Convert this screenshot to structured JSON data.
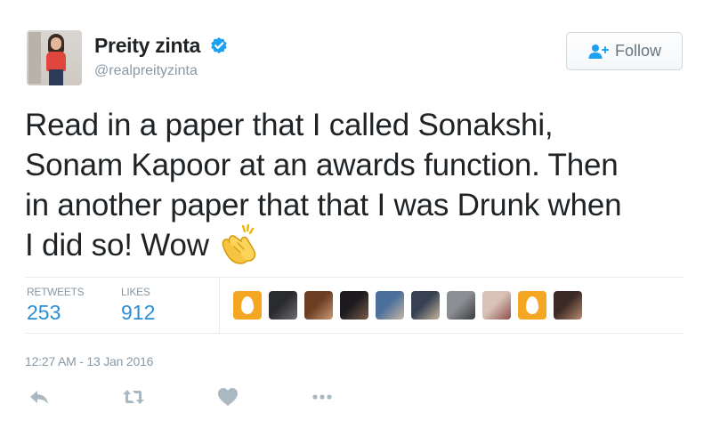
{
  "user": {
    "name": "Preity zinta",
    "handle": "@realpreityzinta",
    "verified": true,
    "avatar_icon": "profile-photo"
  },
  "follow_button": {
    "label": "Follow",
    "icon": "add-user-icon"
  },
  "tweet": {
    "lines": [
      "Read in a paper that I called Sonakshi,",
      "Sonam Kapoor at an awards function. Then",
      "in another paper that that I was Drunk when",
      "I did so! Wow"
    ],
    "emoji": "clapping-hands-emoji"
  },
  "stats": {
    "retweets_label": "RETWEETS",
    "retweets_value": "253",
    "likes_label": "LIKES",
    "likes_value": "912"
  },
  "likers": [
    {
      "kind": "egg",
      "color": "#f5a623"
    },
    {
      "kind": "photo",
      "colors": [
        "#2a2b2e",
        "#6d6e72"
      ]
    },
    {
      "kind": "photo",
      "colors": [
        "#6b3d22",
        "#c99a74"
      ]
    },
    {
      "kind": "photo",
      "colors": [
        "#1d1b1f",
        "#7a5b4c"
      ]
    },
    {
      "kind": "photo",
      "colors": [
        "#4c6f9c",
        "#c7b7a3"
      ]
    },
    {
      "kind": "photo",
      "colors": [
        "#374152",
        "#c6b49a"
      ]
    },
    {
      "kind": "photo",
      "colors": [
        "#8c8f93",
        "#3b3c3f"
      ]
    },
    {
      "kind": "photo",
      "colors": [
        "#d8c2b7",
        "#8e4f4b"
      ]
    },
    {
      "kind": "egg",
      "color": "#f5a623"
    },
    {
      "kind": "photo",
      "colors": [
        "#3b2a26",
        "#b98a6e"
      ]
    }
  ],
  "timestamp": "12:27 AM - 13 Jan 2016",
  "actions": [
    {
      "name": "reply-icon"
    },
    {
      "name": "retweet-icon"
    },
    {
      "name": "like-icon"
    },
    {
      "name": "more-icon"
    }
  ],
  "colors": {
    "link_blue": "#2a8ed6",
    "muted_gray": "#8899a6",
    "verified_blue": "#1da1f2",
    "action_gray": "#aab8c2"
  }
}
